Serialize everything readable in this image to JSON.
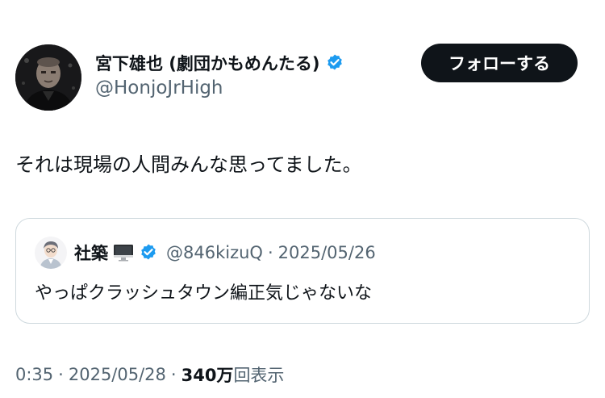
{
  "author": {
    "display_name": "宮下雄也 (劇団かもめんたる)",
    "handle": "@HonjoJrHigh",
    "verified_icon": "verified-badge-icon",
    "avatar_icon": "profile-photo"
  },
  "follow_button": {
    "label": "フォローする"
  },
  "tweet": {
    "text": "それは現場の人間みんな思ってました。"
  },
  "quoted_tweet": {
    "display_name": "社築",
    "name_emoji_icon": "desktop-computer-icon",
    "handle": "@846kizuQ",
    "separator": "·",
    "date": "2025/05/26",
    "text": "やっぱクラッシュタウン編正気じゃないな"
  },
  "meta": {
    "time": "0:35",
    "separator1": "·",
    "date": "2025/05/28",
    "separator2": "·",
    "views_count": "340万",
    "views_label": "回表示"
  },
  "colors": {
    "primary_text": "#0f1419",
    "secondary_text": "#536471",
    "verified_blue": "#1d9bf0",
    "border": "#cfd9de",
    "button_bg": "#0f1419"
  }
}
